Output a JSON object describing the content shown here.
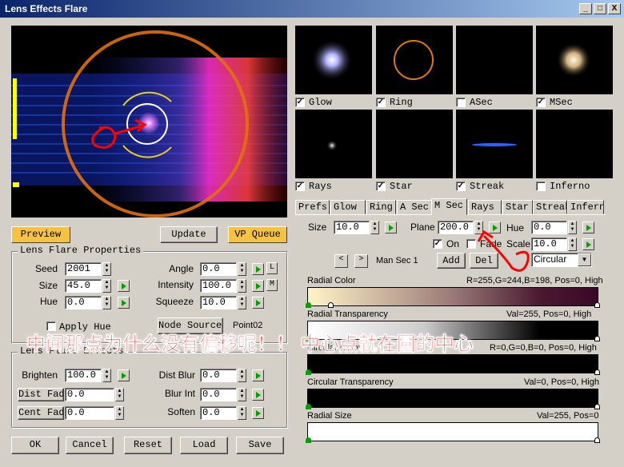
{
  "window": {
    "title": "Lens Effects Flare",
    "min": "_",
    "max": "□",
    "close": "X"
  },
  "buttons": {
    "preview": "Preview",
    "update": "Update",
    "vp_queue": "VP Queue",
    "node_sources": "Node Sources",
    "add": "Add",
    "del": "Del",
    "ok": "OK",
    "cancel": "Cancel",
    "reset": "Reset",
    "load": "Load",
    "save": "Save",
    "l": "L",
    "m": "M"
  },
  "props": {
    "title": "Lens Flare Properties",
    "seed_label": "Seed",
    "seed": "2001",
    "size_label": "Size",
    "size": "45.0",
    "hue_label": "Hue",
    "hue": "0.0",
    "angle_label": "Angle",
    "angle": "0.0",
    "intensity_label": "Intensity",
    "intensity": "100.0",
    "squeeze_label": "Squeeze",
    "squeeze": "10.0",
    "apply_hue": "Apply Hue",
    "node_value": "Point02"
  },
  "effects": {
    "title": "Lens Flare Effects",
    "brighten_label": "Brighten",
    "brighten": "100.0",
    "dist_fade_label": "Dist Fade",
    "dist_fade": "0.0",
    "cent_fade_label": "Cent Fade",
    "cent_fade": "0.0",
    "dist_blur_label": "Dist Blur",
    "dist_blur": "0.0",
    "blur_int_label": "Blur Int",
    "blur_int": "0.0",
    "soften_label": "Soften",
    "soften": "0.0"
  },
  "thumbs": [
    {
      "label": "Glow",
      "checked": true
    },
    {
      "label": "Ring",
      "checked": true
    },
    {
      "label": "ASec",
      "checked": false
    },
    {
      "label": "MSec",
      "checked": true
    },
    {
      "label": "Rays",
      "checked": true
    },
    {
      "label": "Star",
      "checked": true
    },
    {
      "label": "Streak",
      "checked": true
    },
    {
      "label": "Inferno",
      "checked": false
    }
  ],
  "tabs": [
    "Prefs",
    "Glow",
    "Ring",
    "A Sec",
    "M Sec",
    "Rays",
    "Star",
    "Streak",
    "Inferno"
  ],
  "msec": {
    "size_label": "Size",
    "size": "10.0",
    "plane_label": "Plane",
    "plane": "200.0",
    "hue_label": "Hue",
    "hue": "0.0",
    "on_label": "On",
    "fade_label": "Fade",
    "scale_label": "Scale",
    "scale": "10.0",
    "nav_name": "Man Sec 1",
    "shape": "Circular",
    "check": "✓"
  },
  "gradients": {
    "radial_color": "Radial Color",
    "radial_color_val": "R=255,G=244,B=198, Pos=0, High",
    "radial_trans": "Radial Transparency",
    "radial_trans_val": "Val=255, Pos=0, High",
    "circ_color": "Circular Color",
    "circ_color_val": "R=0,G=0,B=0, Pos=0, High",
    "circ_trans": "Circular Transparency",
    "circ_trans_val": "Val=0, Pos=0, High",
    "radial_size": "Radial Size",
    "radial_size_val": "Val=255, Pos=0"
  },
  "annotation": "中间那点为什么没有偏移呢！！ 中心点就在圆的中心",
  "colors": {
    "accent": "#f5c242",
    "annotation": "#ff0000"
  }
}
